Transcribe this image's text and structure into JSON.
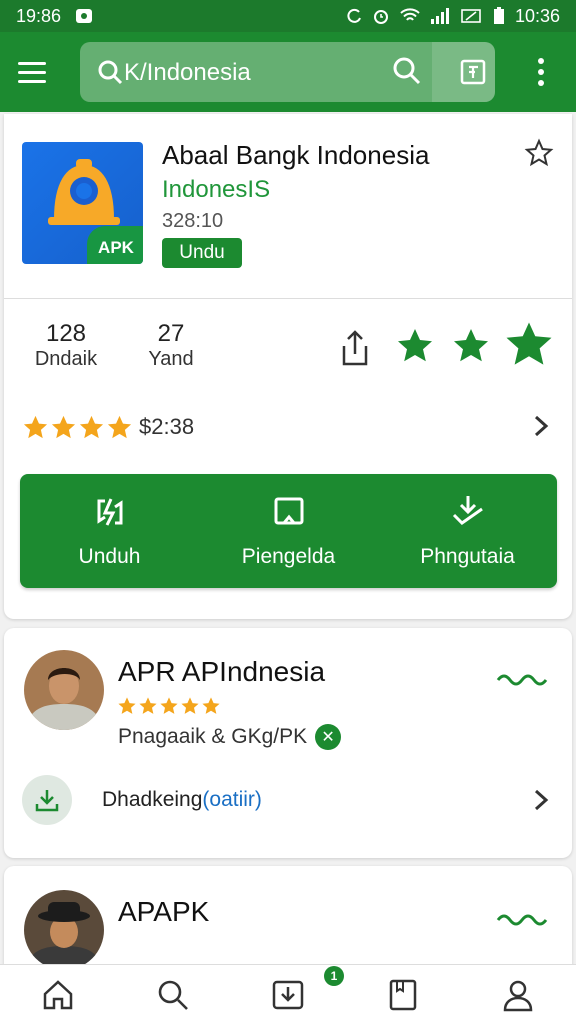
{
  "status_bar": {
    "time": "19:86",
    "right_time": "10:36"
  },
  "search": {
    "value": "K/Indonesia"
  },
  "app": {
    "title": "Abaal Bangk Indonesia",
    "subtitle": "IndonesIS",
    "version": "328:10",
    "install_label": "Undu",
    "badge": "APK"
  },
  "stats": [
    {
      "value": "128",
      "label": "Dndaik"
    },
    {
      "value": "27",
      "label": "Yand"
    }
  ],
  "rating": {
    "stars": 4,
    "price": "$2:38"
  },
  "actions": [
    {
      "icon": "refresh-icon",
      "label": "Unduh"
    },
    {
      "icon": "tablet-icon",
      "label": "Piengelda"
    },
    {
      "icon": "download-check-icon",
      "label": "Phngutaia"
    }
  ],
  "reviews": [
    {
      "name": "APR APIndnesia",
      "stars": 5,
      "meta": "Pnagaaik & GKg/PK",
      "download_text": "Dhadkeing",
      "download_link": "(oatiir)"
    },
    {
      "name": "APAPK"
    }
  ],
  "bottom_nav": [
    {
      "icon": "home-icon"
    },
    {
      "icon": "search-icon"
    },
    {
      "icon": "downloads-icon",
      "badge": "1"
    },
    {
      "icon": "library-icon"
    },
    {
      "icon": "profile-icon"
    }
  ],
  "colors": {
    "primary": "#1c8a30",
    "accent": "#20963a",
    "star": "#f4a51c",
    "link": "#1a6fc4"
  }
}
